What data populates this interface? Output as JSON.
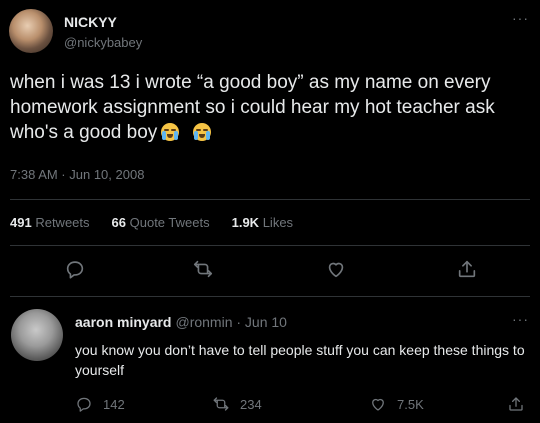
{
  "tweet": {
    "display_name": "NICKYY",
    "handle": "@nickybabey",
    "text": "when i was 13 i wrote “a good boy” as my name on every homework assignment so i could hear my hot teacher ask who's a good  boy",
    "emoji": [
      "loudly-crying-face",
      "loudly-crying-face"
    ],
    "timestamp": "7:38 AM · Jun 10, 2008",
    "stats": {
      "retweets_count": "491",
      "retweets_label": "Retweets",
      "quote_count": "66",
      "quote_label": "Quote Tweets",
      "likes_count": "1.9K",
      "likes_label": "Likes"
    },
    "actions": [
      "reply-icon",
      "retweet-icon",
      "like-icon",
      "share-icon"
    ],
    "more_label": "···"
  },
  "reply": {
    "display_name": "aaron minyard",
    "meta": "@ronmin · Jun 10",
    "text": "you know you don’t have to tell people stuff you can keep these things to yourself",
    "more_label": "···",
    "counts": {
      "replies": "142",
      "retweets": "234",
      "likes": "7.5K"
    }
  },
  "colors": {
    "background": "#000000",
    "text": "#e7e9ea",
    "secondary": "#71767b",
    "divider": "#2f3336"
  }
}
